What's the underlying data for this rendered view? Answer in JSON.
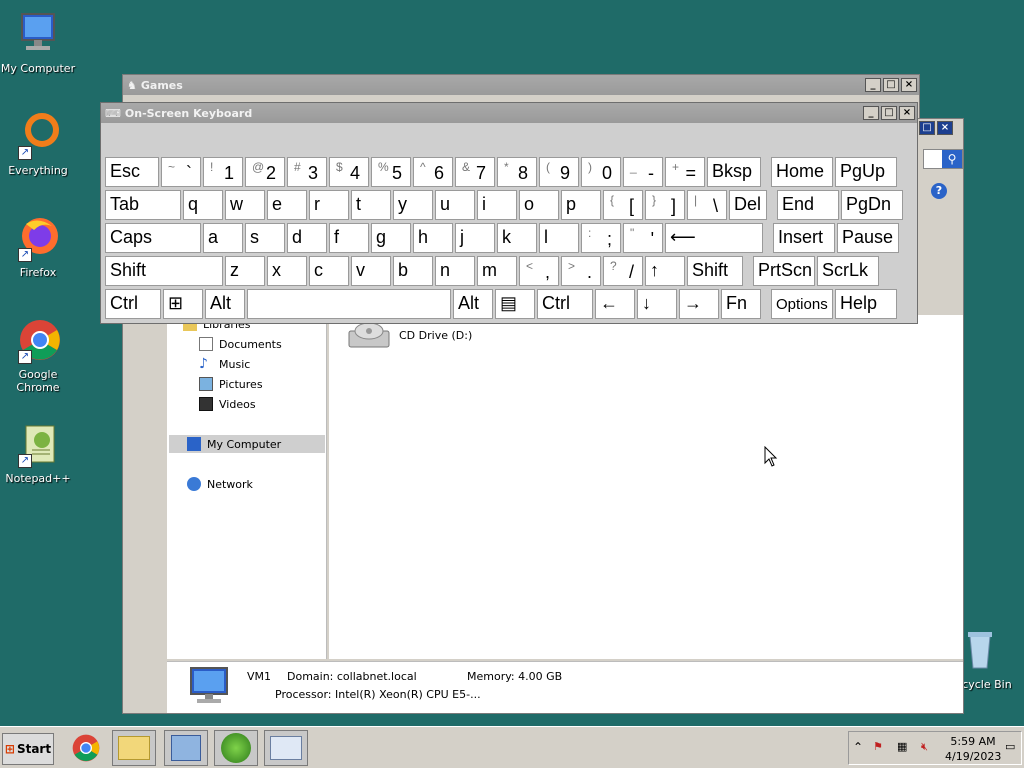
{
  "desktop": {
    "icons": [
      {
        "label": "My Computer"
      },
      {
        "label": "Everything"
      },
      {
        "label": "Firefox"
      },
      {
        "label": "Google Chrome"
      },
      {
        "label": "Notepad++"
      },
      {
        "label": "Recycle Bin"
      }
    ]
  },
  "games_window": {
    "title": "Games"
  },
  "osk": {
    "title": "On-Screen Keyboard",
    "rows": [
      [
        {
          "main": "Esc"
        },
        {
          "sub": "~",
          "lo": "`"
        },
        {
          "sub": "!",
          "lo": "1"
        },
        {
          "sub": "@",
          "lo": "2"
        },
        {
          "sub": "#",
          "lo": "3"
        },
        {
          "sub": "$",
          "lo": "4"
        },
        {
          "sub": "%",
          "lo": "5"
        },
        {
          "sub": "^",
          "lo": "6"
        },
        {
          "sub": "&",
          "lo": "7"
        },
        {
          "sub": "*",
          "lo": "8"
        },
        {
          "sub": "(",
          "lo": "9"
        },
        {
          "sub": ")",
          "lo": "0"
        },
        {
          "sub": "_",
          "lo": "-"
        },
        {
          "sub": "+",
          "lo": "="
        },
        {
          "main": "Bksp"
        },
        {
          "main": "Home"
        },
        {
          "main": "PgUp"
        }
      ],
      [
        {
          "main": "Tab"
        },
        {
          "main": "q"
        },
        {
          "main": "w"
        },
        {
          "main": "e"
        },
        {
          "main": "r"
        },
        {
          "main": "t"
        },
        {
          "main": "y"
        },
        {
          "main": "u"
        },
        {
          "main": "i"
        },
        {
          "main": "o"
        },
        {
          "main": "p"
        },
        {
          "sub": "{",
          "lo": "["
        },
        {
          "sub": "}",
          "lo": "]"
        },
        {
          "sub": "|",
          "lo": "\\"
        },
        {
          "main": "Del"
        },
        {
          "main": "End"
        },
        {
          "main": "PgDn"
        }
      ],
      [
        {
          "main": "Caps"
        },
        {
          "main": "a"
        },
        {
          "main": "s"
        },
        {
          "main": "d"
        },
        {
          "main": "f"
        },
        {
          "main": "g"
        },
        {
          "main": "h"
        },
        {
          "main": "j"
        },
        {
          "main": "k"
        },
        {
          "main": "l"
        },
        {
          "sub": ":",
          "lo": ";"
        },
        {
          "sub": "\"",
          "lo": "'"
        },
        {
          "main": "⟵"
        },
        {
          "main": "Insert"
        },
        {
          "main": "Pause"
        }
      ],
      [
        {
          "main": "Shift"
        },
        {
          "main": "z"
        },
        {
          "main": "x"
        },
        {
          "main": "c"
        },
        {
          "main": "v"
        },
        {
          "main": "b"
        },
        {
          "main": "n"
        },
        {
          "main": "m"
        },
        {
          "sub": "<",
          "lo": ","
        },
        {
          "sub": ">",
          "lo": "."
        },
        {
          "sub": "?",
          "lo": "/"
        },
        {
          "main": "↑"
        },
        {
          "main": "Shift"
        },
        {
          "main": "PrtScn"
        },
        {
          "main": "ScrLk"
        }
      ],
      [
        {
          "main": "Ctrl"
        },
        {
          "main": "⊞"
        },
        {
          "main": "Alt"
        },
        {
          "main": ""
        },
        {
          "main": "Alt"
        },
        {
          "main": "▤"
        },
        {
          "main": "Ctrl"
        },
        {
          "main": "←"
        },
        {
          "main": "↓"
        },
        {
          "main": "→"
        },
        {
          "main": "Fn"
        },
        {
          "main": "Options"
        },
        {
          "main": "Help"
        }
      ]
    ]
  },
  "explorer": {
    "nav": {
      "libraries": "Libraries",
      "documents": "Documents",
      "music": "Music",
      "pictures": "Pictures",
      "videos": "Videos",
      "my_computer": "My Computer",
      "network": "Network"
    },
    "cd_drive": "CD Drive (D:)",
    "details": {
      "name": "VM1",
      "domain": "Domain: collabnet.local",
      "memory": "Memory: 4.00 GB",
      "processor": "Processor: Intel(R) Xeon(R) CPU E5-..."
    }
  },
  "taskbar": {
    "start_label": "Start",
    "clock_time": "5:59 AM",
    "clock_date": "4/19/2023"
  }
}
